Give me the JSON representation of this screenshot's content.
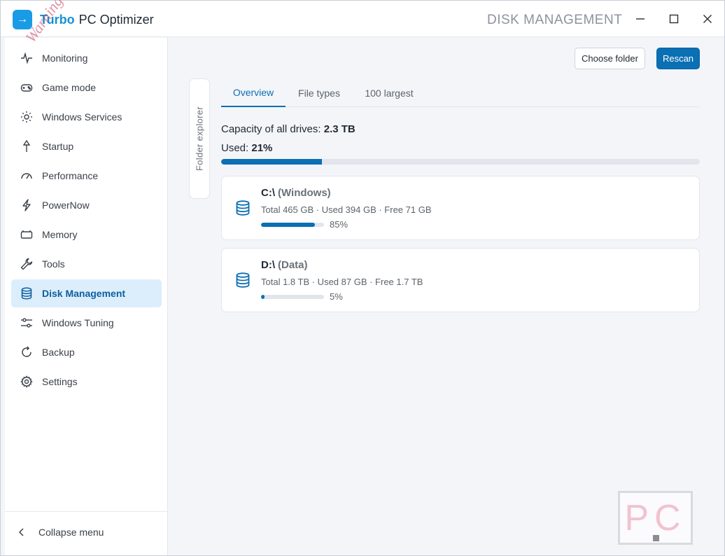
{
  "titlebar": {
    "brand": "Turbo",
    "product": "PC Optimizer",
    "page_caption": "DISK MANAGEMENT",
    "logo_icon": "arrow-right-icon"
  },
  "sidebar": {
    "items": [
      {
        "label": "Monitoring",
        "icon": "pulse-icon"
      },
      {
        "label": "Game mode",
        "icon": "gamepad-icon"
      },
      {
        "label": "Windows Services",
        "icon": "sun-gear-icon"
      },
      {
        "label": "Startup",
        "icon": "rocket-icon"
      },
      {
        "label": "Performance",
        "icon": "gauge-icon"
      },
      {
        "label": "PowerNow",
        "icon": "lightning-icon"
      },
      {
        "label": "Memory",
        "icon": "memory-chip-icon"
      },
      {
        "label": "Tools",
        "icon": "wrench-icon"
      },
      {
        "label": "Disk Management",
        "icon": "database-icon",
        "active": true
      },
      {
        "label": "Windows Tuning",
        "icon": "sliders-icon"
      },
      {
        "label": "Backup",
        "icon": "refresh-icon"
      },
      {
        "label": "Settings",
        "icon": "gear-icon"
      }
    ],
    "collapse_label": "Collapse menu"
  },
  "toolbar": {
    "choose_folder": "Choose folder",
    "rescan": "Rescan"
  },
  "folder_explorer_label": "Folder explorer",
  "tabs": [
    {
      "label": "Overview",
      "active": true
    },
    {
      "label": "File types"
    },
    {
      "label": "100 largest"
    }
  ],
  "summary": {
    "capacity_label": "Capacity of all drives:",
    "capacity_value": "2.3 TB",
    "used_label": "Used:",
    "used_value": "21%",
    "used_fraction": 0.21
  },
  "drives": [
    {
      "letter": "C:\\",
      "name": "(Windows)",
      "stats": "Total 465 GB · Used 394 GB · Free 71 GB",
      "percent_label": "85%",
      "fraction": 0.85
    },
    {
      "letter": "D:\\",
      "name": "(Data)",
      "stats": "Total 1.8 TB · Used 87 GB · Free 1.7 TB",
      "percent_label": "5%",
      "fraction": 0.05
    }
  ],
  "watermarks": {
    "side_script": "Warning",
    "side_pc": "PC",
    "box_text": "PC"
  },
  "colors": {
    "accent": "#0b6fb3",
    "brand": "#1591d6",
    "active_nav_bg": "#dceefc"
  }
}
